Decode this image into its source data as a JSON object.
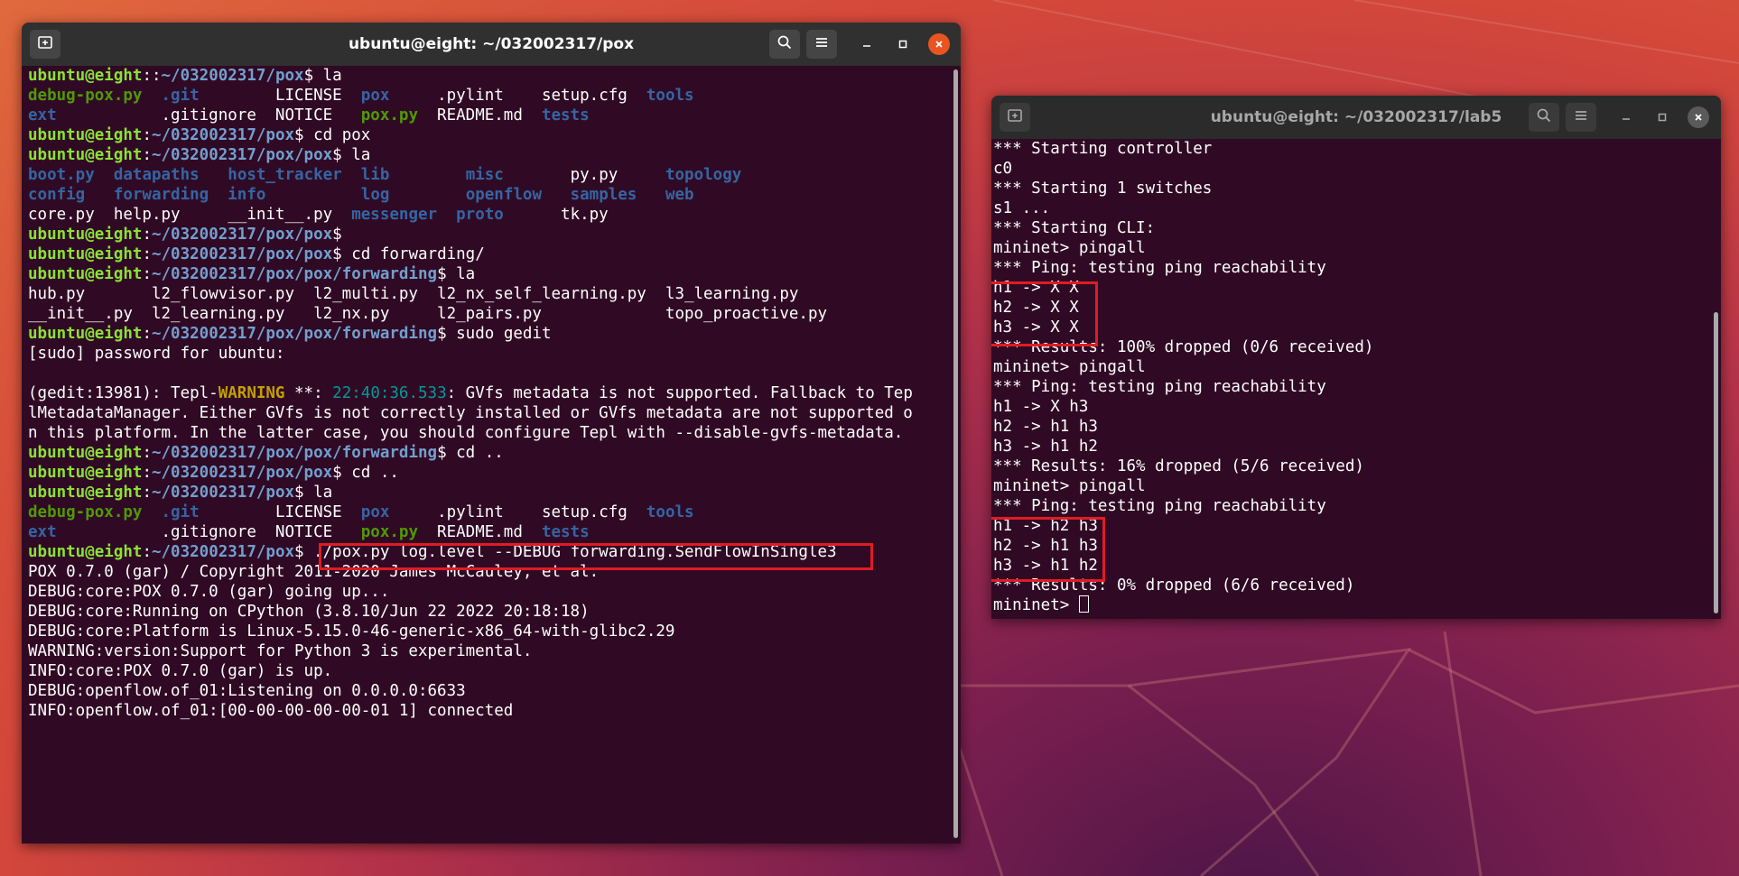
{
  "left_window": {
    "title": "ubuntu@eight: ~/032002317/pox",
    "lines": [
      [
        [
          "user",
          "ubuntu@eight"
        ],
        [
          "",
          "::"
        ],
        [
          "path",
          "~/032002317/pox"
        ],
        [
          "",
          "$ la"
        ]
      ],
      [
        [
          "exe",
          "debug-pox.py"
        ],
        [
          "",
          "  "
        ],
        [
          "dir",
          ".git"
        ],
        [
          "",
          "        LICENSE  "
        ],
        [
          "dir",
          "pox"
        ],
        [
          "",
          "     .pylint    setup.cfg  "
        ],
        [
          "dir",
          "tools"
        ]
      ],
      [
        [
          "dir",
          "ext"
        ],
        [
          "",
          "           .gitignore  NOTICE   "
        ],
        [
          "exe",
          "pox.py"
        ],
        [
          "",
          "  README.md  "
        ],
        [
          "dir",
          "tests"
        ]
      ],
      [
        [
          "user",
          "ubuntu@eight"
        ],
        [
          "",
          ":"
        ],
        [
          "path",
          "~/032002317/pox"
        ],
        [
          "",
          "$ cd pox"
        ]
      ],
      [
        [
          "user",
          "ubuntu@eight"
        ],
        [
          "",
          ":"
        ],
        [
          "path",
          "~/032002317/pox/pox"
        ],
        [
          "",
          "$ la"
        ]
      ],
      [
        [
          "dir",
          "boot.py"
        ],
        [
          "",
          "  "
        ],
        [
          "dir",
          "datapaths"
        ],
        [
          "",
          "   "
        ],
        [
          "dir",
          "host_tracker"
        ],
        [
          "",
          "  "
        ],
        [
          "dir",
          "lib"
        ],
        [
          "",
          "        "
        ],
        [
          "dir",
          "misc"
        ],
        [
          "",
          "       py.py     "
        ],
        [
          "dir",
          "topology"
        ]
      ],
      [
        [
          "dir",
          "config"
        ],
        [
          "",
          "   "
        ],
        [
          "dir",
          "forwarding"
        ],
        [
          "",
          "  "
        ],
        [
          "dir",
          "info"
        ],
        [
          "",
          "          "
        ],
        [
          "dir",
          "log"
        ],
        [
          "",
          "        "
        ],
        [
          "dir",
          "openflow"
        ],
        [
          "",
          "   "
        ],
        [
          "dir",
          "samples"
        ],
        [
          "",
          "   "
        ],
        [
          "dir",
          "web"
        ]
      ],
      [
        [
          "",
          "core.py  help.py     __init__.py  "
        ],
        [
          "dir",
          "messenger"
        ],
        [
          "",
          "  "
        ],
        [
          "dir",
          "proto"
        ],
        [
          "",
          "      tk.py"
        ]
      ],
      [
        [
          "user",
          "ubuntu@eight"
        ],
        [
          "",
          ":"
        ],
        [
          "path",
          "~/032002317/pox/pox"
        ],
        [
          "",
          "$"
        ]
      ],
      [
        [
          "user",
          "ubuntu@eight"
        ],
        [
          "",
          ":"
        ],
        [
          "path",
          "~/032002317/pox/pox"
        ],
        [
          "",
          "$ cd forwarding/"
        ]
      ],
      [
        [
          "user",
          "ubuntu@eight"
        ],
        [
          "",
          ":"
        ],
        [
          "path",
          "~/032002317/pox/pox/forwarding"
        ],
        [
          "",
          "$ la"
        ]
      ],
      [
        [
          "",
          "hub.py       l2_flowvisor.py  l2_multi.py  l2_nx_self_learning.py  l3_learning.py"
        ]
      ],
      [
        [
          "",
          "__init__.py  l2_learning.py   l2_nx.py     l2_pairs.py             topo_proactive.py"
        ]
      ],
      [
        [
          "user",
          "ubuntu@eight"
        ],
        [
          "",
          ":"
        ],
        [
          "path",
          "~/032002317/pox/pox/forwarding"
        ],
        [
          "",
          "$ sudo gedit"
        ]
      ],
      [
        [
          "",
          "[sudo] password for ubuntu:"
        ]
      ],
      [
        [
          "",
          ""
        ]
      ],
      [
        [
          "",
          "(gedit:13981): Tepl-"
        ],
        [
          "warn",
          "WARNING"
        ],
        [
          "",
          " **: "
        ],
        [
          "time",
          "22:40:36.533"
        ],
        [
          "",
          ": GVfs metadata is not supported. Fallback to Tep"
        ]
      ],
      [
        [
          "",
          "lMetadataManager. Either GVfs is not correctly installed or GVfs metadata are not supported o"
        ]
      ],
      [
        [
          "",
          "n this platform. In the latter case, you should configure Tepl with --disable-gvfs-metadata."
        ]
      ],
      [
        [
          "user",
          "ubuntu@eight"
        ],
        [
          "",
          ":"
        ],
        [
          "path",
          "~/032002317/pox/pox/forwarding"
        ],
        [
          "",
          "$ cd .."
        ]
      ],
      [
        [
          "user",
          "ubuntu@eight"
        ],
        [
          "",
          ":"
        ],
        [
          "path",
          "~/032002317/pox/pox"
        ],
        [
          "",
          "$ cd .."
        ]
      ],
      [
        [
          "user",
          "ubuntu@eight"
        ],
        [
          "",
          ":"
        ],
        [
          "path",
          "~/032002317/pox"
        ],
        [
          "",
          "$ la"
        ]
      ],
      [
        [
          "exe",
          "debug-pox.py"
        ],
        [
          "",
          "  "
        ],
        [
          "dir",
          ".git"
        ],
        [
          "",
          "        LICENSE  "
        ],
        [
          "dir",
          "pox"
        ],
        [
          "",
          "     .pylint    setup.cfg  "
        ],
        [
          "dir",
          "tools"
        ]
      ],
      [
        [
          "dir",
          "ext"
        ],
        [
          "",
          "           .gitignore  NOTICE   "
        ],
        [
          "exe",
          "pox.py"
        ],
        [
          "",
          "  README.md  "
        ],
        [
          "dir",
          "tests"
        ]
      ],
      [
        [
          "user",
          "ubuntu@eight"
        ],
        [
          "",
          ":"
        ],
        [
          "path",
          "~/032002317/pox"
        ],
        [
          "",
          "$ ./pox.py log.level --DEBUG forwarding.SendFlowInSingle3"
        ]
      ],
      [
        [
          "",
          "POX 0.7.0 (gar) / Copyright 2011-2020 James McCauley, et al."
        ]
      ],
      [
        [
          "",
          "DEBUG:core:POX 0.7.0 (gar) going up..."
        ]
      ],
      [
        [
          "",
          "DEBUG:core:Running on CPython (3.8.10/Jun 22 2022 20:18:18)"
        ]
      ],
      [
        [
          "",
          "DEBUG:core:Platform is Linux-5.15.0-46-generic-x86_64-with-glibc2.29"
        ]
      ],
      [
        [
          "",
          "WARNING:version:Support for Python 3 is experimental."
        ]
      ],
      [
        [
          "",
          "INFO:core:POX 0.7.0 (gar) is up."
        ]
      ],
      [
        [
          "",
          "DEBUG:openflow.of_01:Listening on 0.0.0.0:6633"
        ]
      ],
      [
        [
          "",
          "INFO:openflow.of_01:[00-00-00-00-00-01 1] connected"
        ]
      ]
    ]
  },
  "right_window": {
    "title": "ubuntu@eight: ~/032002317/lab5",
    "lines": [
      "*** Starting controller",
      "c0",
      "*** Starting 1 switches",
      "s1 ...",
      "*** Starting CLI:",
      "mininet> pingall",
      "*** Ping: testing ping reachability",
      "h1 -> X X",
      "h2 -> X X",
      "h3 -> X X",
      "*** Results: 100% dropped (0/6 received)",
      "mininet> pingall",
      "*** Ping: testing ping reachability",
      "h1 -> X h3",
      "h2 -> h1 h3",
      "h3 -> h1 h2",
      "*** Results: 16% dropped (5/6 received)",
      "mininet> pingall",
      "*** Ping: testing ping reachability",
      "h1 -> h2 h3",
      "h2 -> h1 h3",
      "h3 -> h1 h2",
      "*** Results: 0% dropped (6/6 received)"
    ],
    "prompt": "mininet> "
  },
  "colors": {
    "terminal_bg": "#300a24",
    "prompt_user": "#8ae234",
    "prompt_path": "#729fcf",
    "directory": "#3465a4",
    "executable": "#4e9a06",
    "highlight_box": "#e01b24",
    "close_button": "#e95420"
  },
  "icons": {
    "new_tab": "new-tab-icon",
    "search": "search-icon",
    "menu": "hamburger-menu-icon",
    "minimize": "minimize-icon",
    "maximize": "maximize-icon",
    "close": "close-icon"
  }
}
